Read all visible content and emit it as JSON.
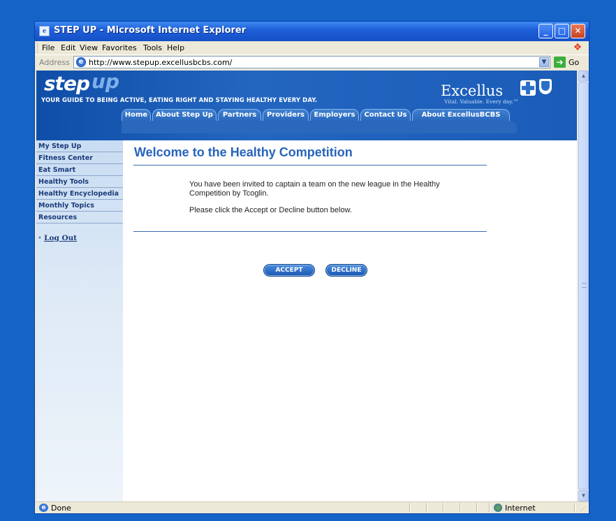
{
  "window": {
    "title": "STEP UP - Microsoft Internet Explorer",
    "app_icon_glyph": "e",
    "minimize_glyph": "_",
    "maximize_glyph": "□",
    "close_glyph": "✕"
  },
  "menu": {
    "items": [
      "File",
      "Edit",
      "View",
      "Favorites",
      "Tools",
      "Help"
    ]
  },
  "address": {
    "label": "Address",
    "url": "http://www.stepup.excellusbcbs.com/",
    "go_label": "Go",
    "page_icon_glyph": "e"
  },
  "site": {
    "logo_step": "step",
    "logo_up": "up",
    "tagline": "YOUR GUIDE TO BEING ACTIVE, EATING RIGHT AND STAYING HEALTHY EVERY DAY.",
    "brand_name": "Excellus",
    "brand_tagline": "Vital. Valuable. Every day.™",
    "nav_tabs": [
      "Home",
      "About Step Up",
      "Partners",
      "Providers",
      "Employers",
      "Contact Us",
      "About ExcellusBCBS"
    ]
  },
  "sidebar": {
    "items": [
      "My Step Up",
      "Fitness Center",
      "Eat Smart",
      "Healthy Tools",
      "Healthy Encyclopedia",
      "Monthly Topics",
      "Resources"
    ],
    "logout_bullet": "•",
    "logout": "Log Out"
  },
  "main": {
    "heading": "Welcome to the Healthy Competition",
    "message_line1": "You have been invited to captain a team on the new league in the Healthy",
    "message_line2": "Competition by Tcoglin.",
    "instruction": "Please click the Accept or Decline button below.",
    "accept_label": "ACCEPT",
    "decline_label": "DECLINE"
  },
  "status": {
    "text": "Done",
    "zone": "Internet"
  },
  "colors": {
    "desktop": "#1464c8",
    "site_header": "#1a5cb8",
    "heading": "#2664bc",
    "sidebar_text": "#1a3a7a"
  },
  "icons": [
    "ie-icon",
    "minimize-icon",
    "maximize-icon",
    "close-icon",
    "windows-logo-icon",
    "page-icon",
    "dropdown-icon",
    "go-arrow-icon",
    "blue-cross-icon",
    "blue-shield-icon",
    "internet-zone-icon",
    "resize-grip-icon"
  ]
}
